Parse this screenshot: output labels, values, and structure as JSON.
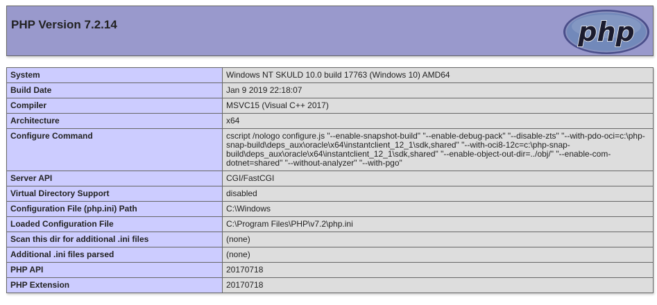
{
  "colors": {
    "header_bg": "#9999cc",
    "key_cell_bg": "#ccccff",
    "value_cell_bg": "#dddddd",
    "logo_bg": "#6181b6"
  },
  "header": {
    "title": "PHP Version 7.2.14",
    "logo_text": "php",
    "logo_icon": "php-logo"
  },
  "rows": [
    {
      "key": "System",
      "value": "Windows NT SKULD 10.0 build 17763 (Windows 10) AMD64"
    },
    {
      "key": "Build Date",
      "value": "Jan 9 2019 22:18:07"
    },
    {
      "key": "Compiler",
      "value": "MSVC15 (Visual C++ 2017)"
    },
    {
      "key": "Architecture",
      "value": "x64"
    },
    {
      "key": "Configure Command",
      "value": "cscript /nologo configure.js \"--enable-snapshot-build\" \"--enable-debug-pack\" \"--disable-zts\" \"--with-pdo-oci=c:\\php-snap-build\\deps_aux\\oracle\\x64\\instantclient_12_1\\sdk,shared\" \"--with-oci8-12c=c:\\php-snap-build\\deps_aux\\oracle\\x64\\instantclient_12_1\\sdk,shared\" \"--enable-object-out-dir=../obj/\" \"--enable-com-dotnet=shared\" \"--without-analyzer\" \"--with-pgo\""
    },
    {
      "key": "Server API",
      "value": "CGI/FastCGI"
    },
    {
      "key": "Virtual Directory Support",
      "value": "disabled"
    },
    {
      "key": "Configuration File (php.ini) Path",
      "value": "C:\\Windows"
    },
    {
      "key": "Loaded Configuration File",
      "value": "C:\\Program Files\\PHP\\v7.2\\php.ini"
    },
    {
      "key": "Scan this dir for additional .ini files",
      "value": "(none)"
    },
    {
      "key": "Additional .ini files parsed",
      "value": "(none)"
    },
    {
      "key": "PHP API",
      "value": "20170718"
    },
    {
      "key": "PHP Extension",
      "value": "20170718"
    }
  ]
}
